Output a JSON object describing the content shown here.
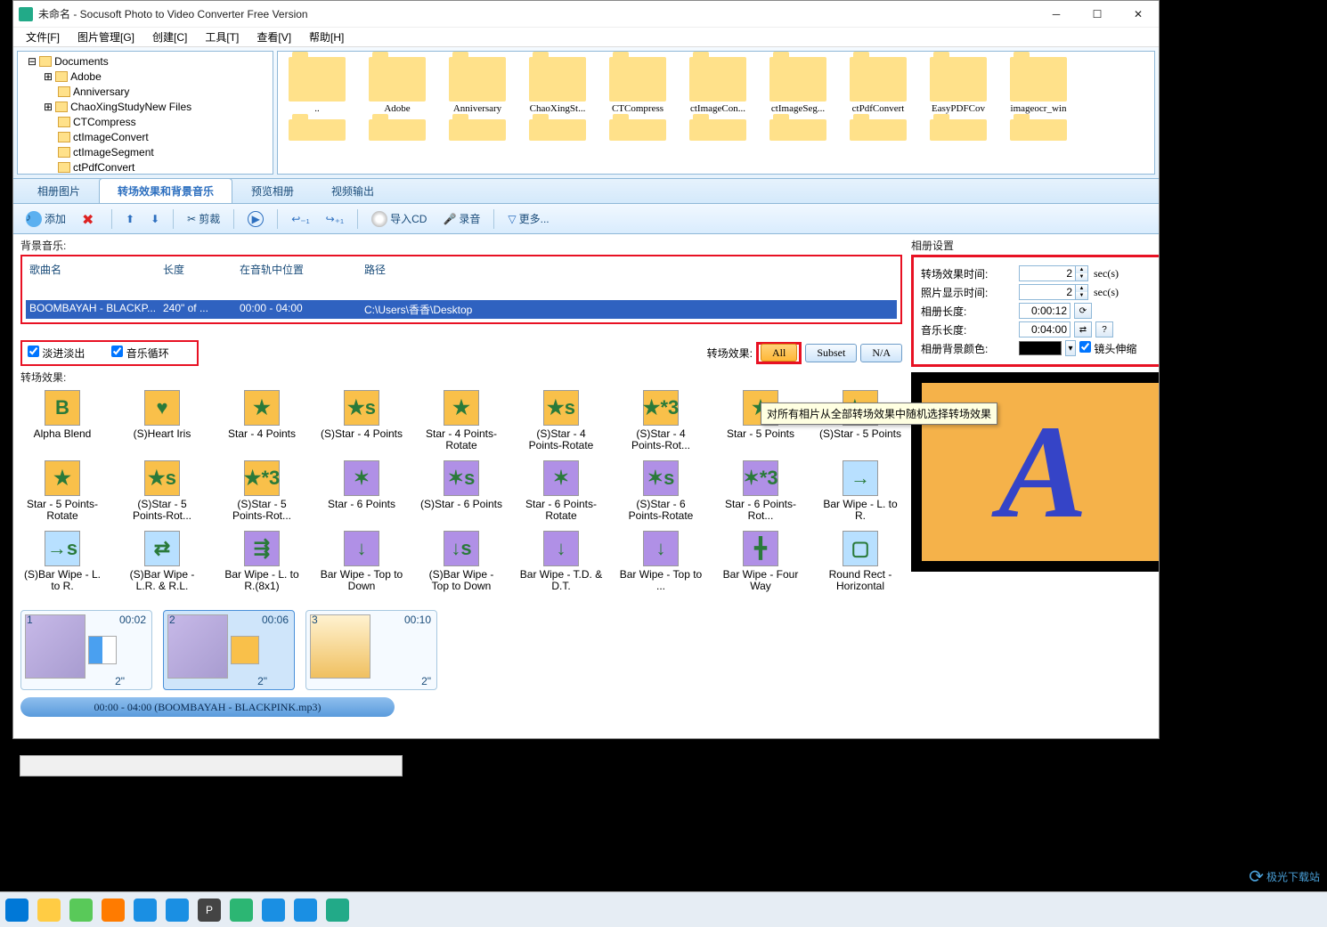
{
  "title": "未命名 - Socusoft Photo to Video Converter Free Version",
  "menu": {
    "file": "文件[F]",
    "pic": "图片管理[G]",
    "create": "创建[C]",
    "tool": "工具[T]",
    "view": "查看[V]",
    "help": "帮助[H]"
  },
  "tree": [
    "Documents",
    "Adobe",
    "Anniversary",
    "ChaoXingStudyNew Files",
    "CTCompress",
    "ctImageConvert",
    "ctImageSegment",
    "ctPdfConvert"
  ],
  "thumbs_r1": [
    "..",
    "Adobe",
    "Anniversary",
    "ChaoXingSt...",
    "CTCompress",
    "ctImageCon...",
    "ctImageSeg...",
    "ctPdfConvert",
    "EasyPDFCov",
    "imageocr_win"
  ],
  "tabs": {
    "t1": "相册图片",
    "t2": "转场效果和背景音乐",
    "t3": "预览相册",
    "t4": "视频输出"
  },
  "toolbar": {
    "add": "添加",
    "cut": "剪裁",
    "importcd": "导入CD",
    "rec": "录音",
    "more": "更多..."
  },
  "labels": {
    "bgmusic": "背景音乐:",
    "transeffect": "转场效果:",
    "albumset": "相册设置",
    "transeff2": "转场效果:"
  },
  "music_head": {
    "name": "歌曲名",
    "len": "长度",
    "pos": "在音轨中位置",
    "path": "路径"
  },
  "music_row": {
    "name": "BOOMBAYAH - BLACKP...",
    "len": "240\" of ...",
    "pos": "00:00 - 04:00",
    "path": "C:\\Users\\香香\\Desktop"
  },
  "cb": {
    "fade": "淡进淡出",
    "loop": "音乐循环",
    "zoom": "镜头伸缩"
  },
  "tb": {
    "all": "All",
    "subset": "Subset",
    "na": "N/A"
  },
  "settings": {
    "transdur": "转场效果时间:",
    "showdur": "照片显示时间:",
    "albumlen": "相册长度:",
    "musiclen": "音乐长度:",
    "bgcolor": "相册背景颜色:",
    "v_trans": "2",
    "v_show": "2",
    "v_album": "0:00:12",
    "v_music": "0:04:00",
    "unit": "sec(s)"
  },
  "effects_r1": [
    "Alpha Blend",
    "(S)Heart Iris",
    "Star - 4 Points",
    "(S)Star - 4 Points",
    "Star - 4 Points-Rotate",
    "(S)Star - 4 Points-Rotate",
    "(S)Star - 4 Points-Rot...",
    "Star - 5 Points",
    "(S)Star - 5 Points"
  ],
  "effects_r2": [
    "Star - 5 Points-Rotate",
    "(S)Star - 5 Points-Rot...",
    "(S)Star - 5 Points-Rot...",
    "Star - 6 Points",
    "(S)Star - 6 Points",
    "Star - 6 Points-Rotate",
    "(S)Star - 6 Points-Rotate",
    "Star - 6 Points-Rot...",
    "Bar Wipe - L. to R."
  ],
  "effects_r3": [
    "(S)Bar Wipe - L. to R.",
    "(S)Bar Wipe - L.R. & R.L.",
    "Bar Wipe - L. to R.(8x1)",
    "Bar Wipe - Top to Down",
    "(S)Bar Wipe - Top to Down",
    "Bar Wipe - T.D. & D.T.",
    "Bar Wipe - Top to ...",
    "Bar Wipe - Four Way",
    "Round Rect - Horizontal"
  ],
  "timeline": {
    "it1": {
      "n": "1",
      "t": "00:02",
      "d": "2\""
    },
    "it2": {
      "n": "2",
      "t": "00:06",
      "d": "2\""
    },
    "it3": {
      "n": "3",
      "t": "00:10",
      "d": "2\""
    }
  },
  "audio_bar": "00:00 - 04:00 (BOOMBAYAH - BLACKPINK.mp3)",
  "tooltip": "对所有相片从全部转场效果中随机选择转场效果",
  "watermark": "极光下载站"
}
